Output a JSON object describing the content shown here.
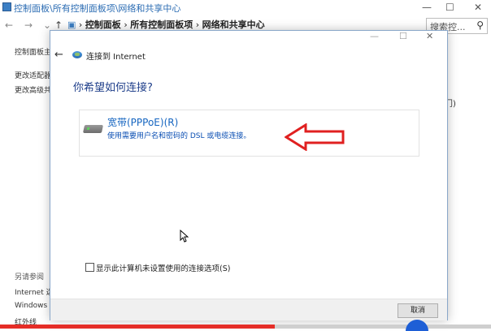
{
  "background": {
    "title": "控制面板\\所有控制面板项\\网络和共享中心",
    "title_buttons": [
      "—",
      "☐",
      "✕"
    ],
    "breadcrumb": [
      "控制面板",
      "所有控制面板项",
      "网络和共享中心"
    ],
    "search_placeholder": "搜索控...",
    "sidebar": {
      "item1": "控制面板主",
      "item2": "更改适配器",
      "item3": "更改高级共",
      "see_also": "另请参阅",
      "link1": "Internet 选",
      "link2": "Windows",
      "link3": "红外线"
    },
    "right_text": "门)"
  },
  "dialog": {
    "title": "连接到 Internet",
    "heading": "你希望如何连接?",
    "option": {
      "title": "宽带(PPPoE)(R)",
      "description": "使用需要用户名和密码的 DSL 或电缆连接。"
    },
    "checkbox_label": "显示此计算机未设置使用的连接选项(S)",
    "cancel_label": "取消"
  },
  "video_progress": 0.56,
  "colors": {
    "accent": "#1565c0",
    "arrow": "#e02020",
    "progress": "#e52d27"
  }
}
